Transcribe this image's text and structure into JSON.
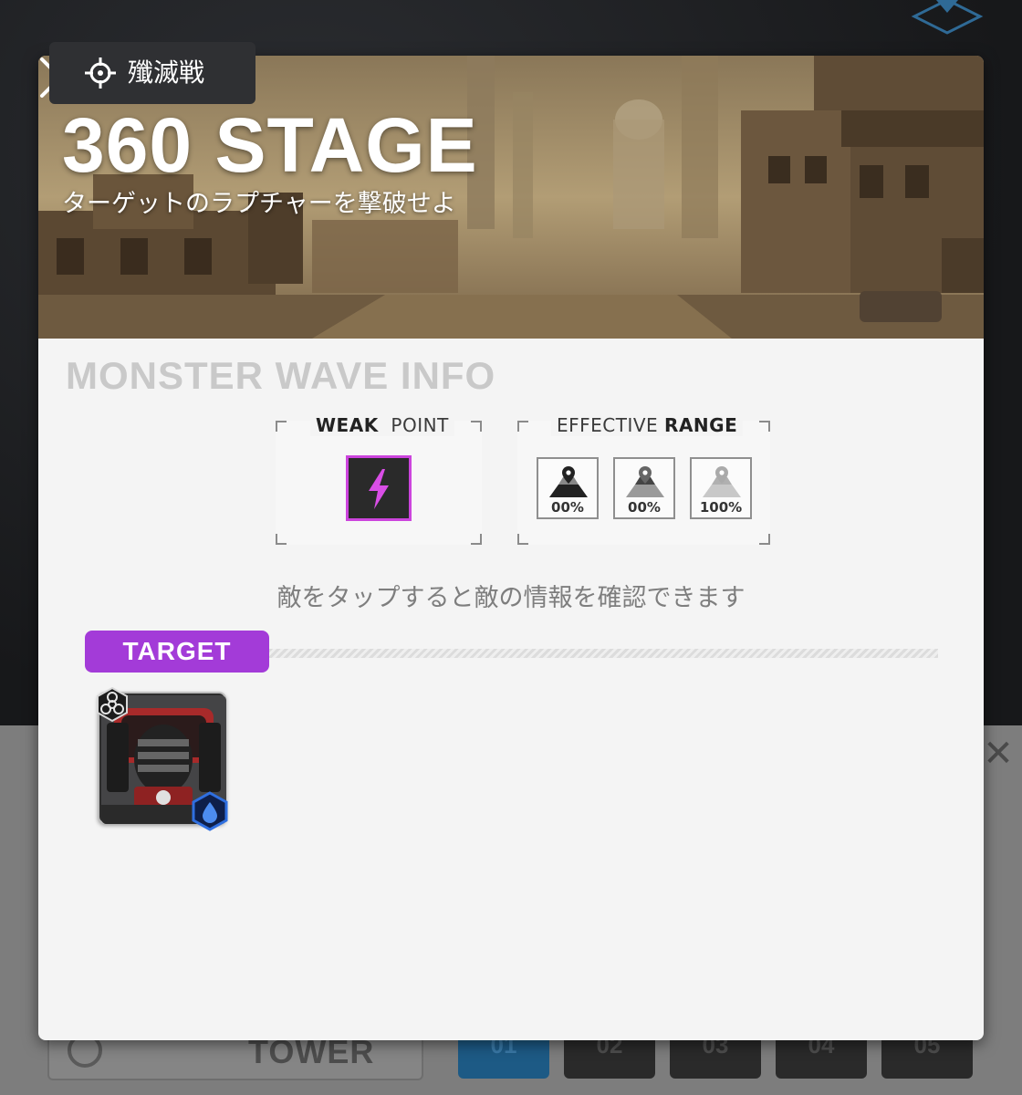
{
  "background": {
    "tower_label": "TOWER",
    "floors": [
      "01",
      "02",
      "03",
      "04",
      "05"
    ]
  },
  "mode_tag": {
    "label": "殲滅戦",
    "icon": "crosshair-icon"
  },
  "stage": {
    "title": "360 STAGE",
    "subtitle": "ターゲットのラプチャーを撃破せよ"
  },
  "section_title": "MONSTER WAVE INFO",
  "weak_point": {
    "label_bold": "WEAK",
    "label_rest": "POINT",
    "icon": "lightning-icon",
    "accent": "#cc44dd"
  },
  "effective_range": {
    "label_rest": "EFFECTIVE",
    "label_bold": "RANGE",
    "tiles": [
      {
        "icon": "range-near-icon",
        "value": "00%"
      },
      {
        "icon": "range-mid-icon",
        "value": "00%"
      },
      {
        "icon": "range-far-icon",
        "value": "100%"
      }
    ]
  },
  "hint": "敵をタップすると敵の情報を確認できます",
  "target": {
    "tab_label": "TARGET",
    "accent": "#a33bd8",
    "enemies": [
      {
        "icon": "rapture-portrait",
        "class_badge": "biohazard-icon",
        "element_badge": "water-drop-icon"
      }
    ]
  }
}
